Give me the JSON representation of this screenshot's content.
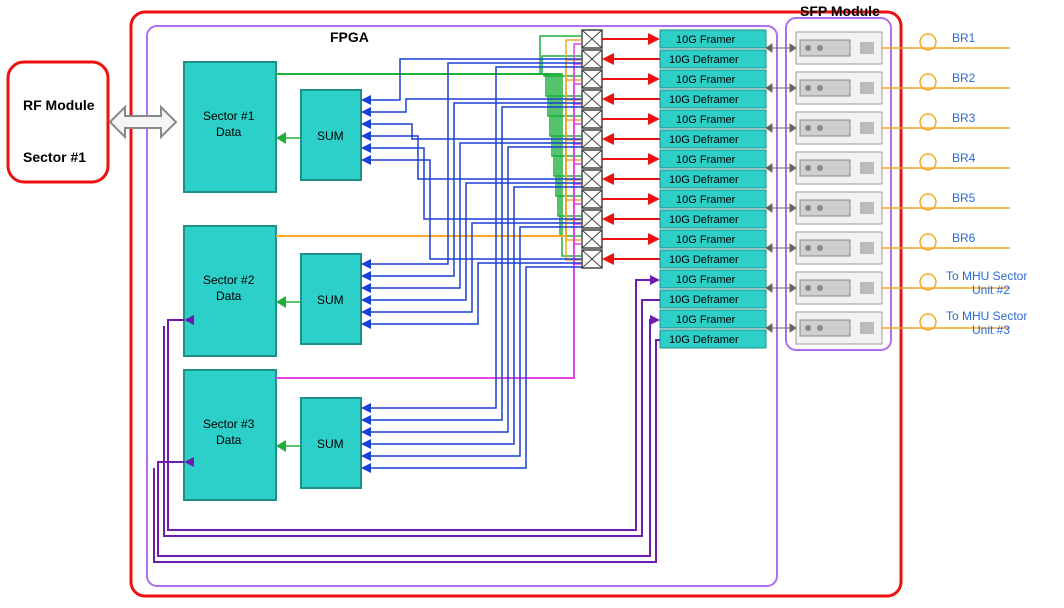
{
  "labels": {
    "fpga": "FPGA",
    "sfp": "SFP Module",
    "rf_l1": "RF Module",
    "rf_l2": "Sector #1",
    "sector1_l1": "Sector #1",
    "sector1_l2": "Data",
    "sector2_l1": "Sector #2",
    "sector2_l2": "Data",
    "sector3_l1": "Sector #3",
    "sector3_l2": "Data",
    "sum": "SUM",
    "framer": "10G Framer",
    "deframer": "10G Deframer",
    "br1": "BR1",
    "br2": "BR2",
    "br3": "BR3",
    "br4": "BR4",
    "br5": "BR5",
    "br6": "BR6",
    "to_sec2_l1": "To MHU Sector",
    "to_sec2_l2": "Unit #2",
    "to_sec3_l1": "To MHU Sector",
    "to_sec3_l2": "Unit #3"
  }
}
